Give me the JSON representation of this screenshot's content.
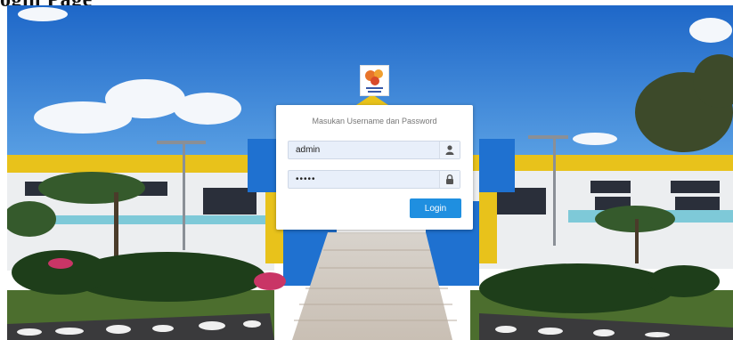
{
  "caption": "ogin Page",
  "login": {
    "title": "Masukan Username dan Password",
    "username_value": "admin",
    "password_value": "•••••",
    "login_button": "Login"
  },
  "icons": {
    "username": "user-icon",
    "password": "lock-icon",
    "logo": "university-logo"
  }
}
